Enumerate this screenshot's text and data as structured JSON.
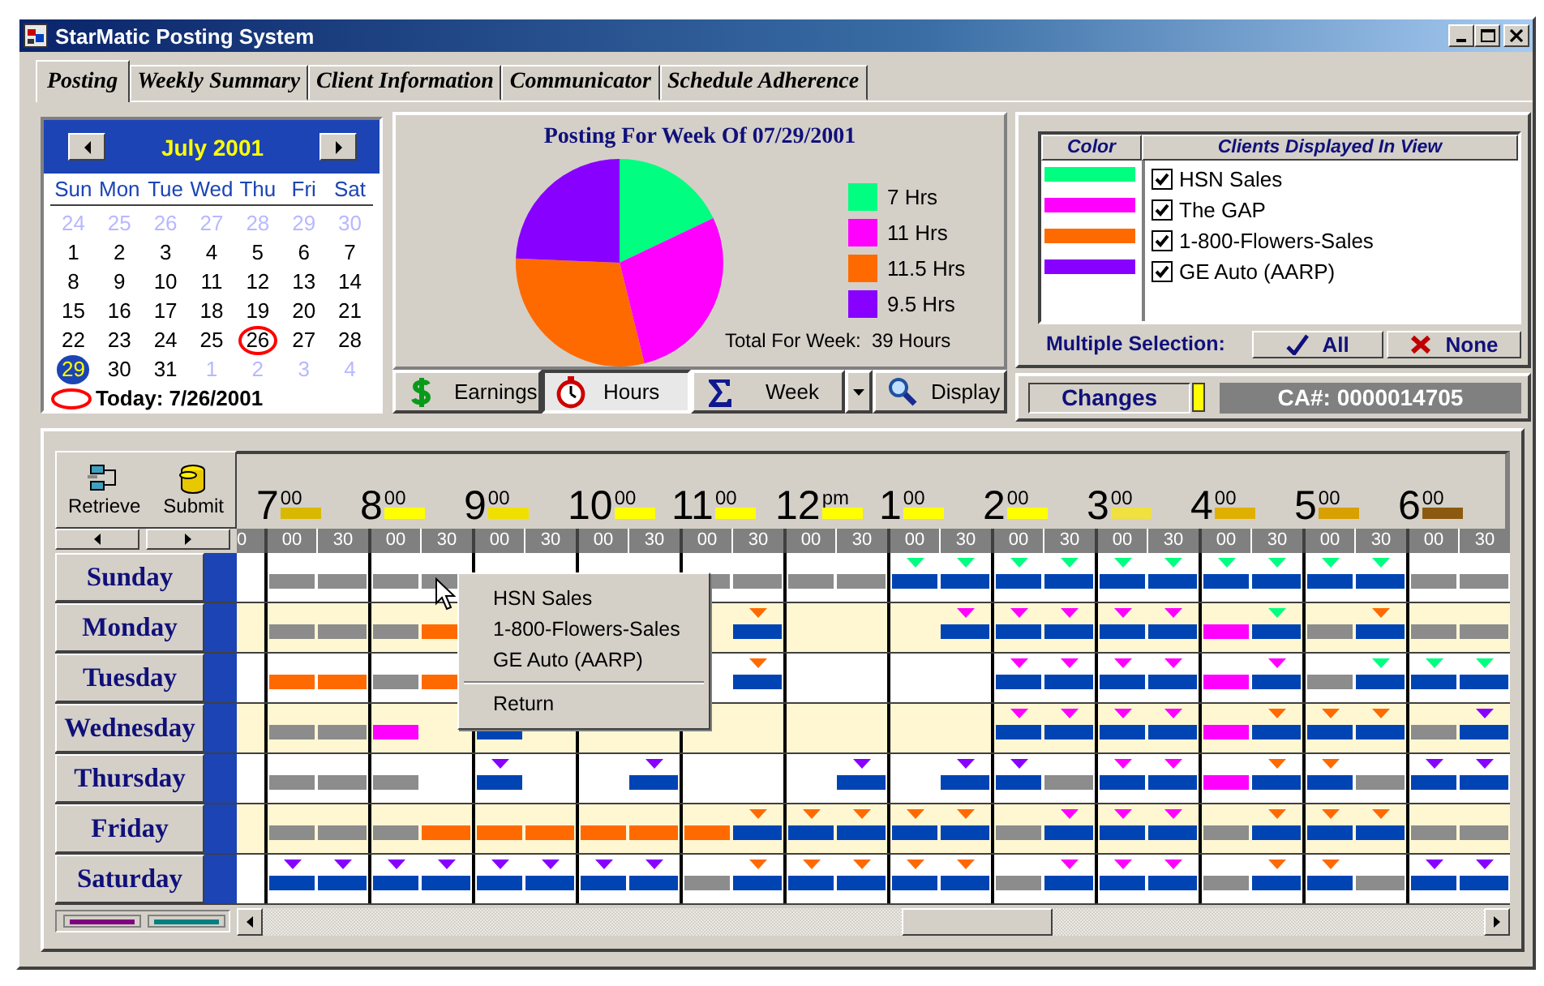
{
  "window": {
    "title": "StarMatic Posting System"
  },
  "tabs": [
    {
      "label": "Posting",
      "selected": true
    },
    {
      "label": "Weekly Summary",
      "selected": false
    },
    {
      "label": "Client Information",
      "selected": false
    },
    {
      "label": "Communicator",
      "selected": false
    },
    {
      "label": "Schedule Adherence",
      "selected": false
    }
  ],
  "calendar": {
    "month": "July 2001",
    "weekdays": [
      "Sun",
      "Mon",
      "Tue",
      "Wed",
      "Thu",
      "Fri",
      "Sat"
    ],
    "days": [
      {
        "label": "24",
        "kind": "other",
        "selected": false,
        "today": false
      },
      {
        "label": "25",
        "kind": "other",
        "selected": false,
        "today": false
      },
      {
        "label": "26",
        "kind": "other",
        "selected": false,
        "today": false
      },
      {
        "label": "27",
        "kind": "other",
        "selected": false,
        "today": false
      },
      {
        "label": "28",
        "kind": "other",
        "selected": false,
        "today": false
      },
      {
        "label": "29",
        "kind": "other",
        "selected": false,
        "today": false
      },
      {
        "label": "30",
        "kind": "other",
        "selected": false,
        "today": false
      },
      {
        "label": "1",
        "kind": "current",
        "selected": false,
        "today": false
      },
      {
        "label": "2",
        "kind": "current",
        "selected": false,
        "today": false
      },
      {
        "label": "3",
        "kind": "current",
        "selected": false,
        "today": false
      },
      {
        "label": "4",
        "kind": "current",
        "selected": false,
        "today": false
      },
      {
        "label": "5",
        "kind": "current",
        "selected": false,
        "today": false
      },
      {
        "label": "6",
        "kind": "current",
        "selected": false,
        "today": false
      },
      {
        "label": "7",
        "kind": "current",
        "selected": false,
        "today": false
      },
      {
        "label": "8",
        "kind": "current",
        "selected": false,
        "today": false
      },
      {
        "label": "9",
        "kind": "current",
        "selected": false,
        "today": false
      },
      {
        "label": "10",
        "kind": "current",
        "selected": false,
        "today": false
      },
      {
        "label": "11",
        "kind": "current",
        "selected": false,
        "today": false
      },
      {
        "label": "12",
        "kind": "current",
        "selected": false,
        "today": false
      },
      {
        "label": "13",
        "kind": "current",
        "selected": false,
        "today": false
      },
      {
        "label": "14",
        "kind": "current",
        "selected": false,
        "today": false
      },
      {
        "label": "15",
        "kind": "current",
        "selected": false,
        "today": false
      },
      {
        "label": "16",
        "kind": "current",
        "selected": false,
        "today": false
      },
      {
        "label": "17",
        "kind": "current",
        "selected": false,
        "today": false
      },
      {
        "label": "18",
        "kind": "current",
        "selected": false,
        "today": false
      },
      {
        "label": "19",
        "kind": "current",
        "selected": false,
        "today": false
      },
      {
        "label": "20",
        "kind": "current",
        "selected": false,
        "today": false
      },
      {
        "label": "21",
        "kind": "current",
        "selected": false,
        "today": false
      },
      {
        "label": "22",
        "kind": "current",
        "selected": false,
        "today": false
      },
      {
        "label": "23",
        "kind": "current",
        "selected": false,
        "today": false
      },
      {
        "label": "24",
        "kind": "current",
        "selected": false,
        "today": false
      },
      {
        "label": "25",
        "kind": "current",
        "selected": false,
        "today": false
      },
      {
        "label": "26",
        "kind": "current",
        "selected": false,
        "today": true
      },
      {
        "label": "27",
        "kind": "current",
        "selected": false,
        "today": false
      },
      {
        "label": "28",
        "kind": "current",
        "selected": false,
        "today": false
      },
      {
        "label": "29",
        "kind": "current",
        "selected": true,
        "today": false
      },
      {
        "label": "30",
        "kind": "current",
        "selected": false,
        "today": false
      },
      {
        "label": "31",
        "kind": "current",
        "selected": false,
        "today": false
      },
      {
        "label": "1",
        "kind": "other",
        "selected": false,
        "today": false
      },
      {
        "label": "2",
        "kind": "other",
        "selected": false,
        "today": false
      },
      {
        "label": "3",
        "kind": "other",
        "selected": false,
        "today": false
      },
      {
        "label": "4",
        "kind": "other",
        "selected": false,
        "today": false
      }
    ],
    "today_label": "Today: 7/26/2001"
  },
  "chart_panel": {
    "chart_data": {
      "type": "pie",
      "title": "Posting For Week Of 07/29/2001",
      "categories": [
        "7 Hrs",
        "11 Hrs",
        "11.5 Hrs",
        "9.5 Hrs"
      ],
      "values": [
        7,
        11,
        11.5,
        9.5
      ],
      "colors": [
        "#00ff80",
        "#ff00ff",
        "#ff6a00",
        "#8800ff"
      ],
      "legend": "right"
    },
    "total": "Total For Week:  39 Hours"
  },
  "view_buttons": [
    {
      "label": "Earnings",
      "kind": "button",
      "selected": false
    },
    {
      "label": "Hours",
      "kind": "button",
      "selected": true
    },
    {
      "label": "Week",
      "kind": "dropdown",
      "selected": false
    },
    {
      "label": "Display",
      "kind": "button",
      "selected": false
    }
  ],
  "clients": {
    "headers": [
      "Color",
      "Clients Displayed In View"
    ],
    "items": [
      {
        "name": "HSN Sales",
        "color": "#00ff80",
        "checked": true
      },
      {
        "name": "The GAP",
        "color": "#ff00ff",
        "checked": true
      },
      {
        "name": "1-800-Flowers-Sales",
        "color": "#ff6a00",
        "checked": true
      },
      {
        "name": "GE Auto (AARP)",
        "color": "#8800ff",
        "checked": true
      }
    ],
    "selection_label": "Multiple Selection:",
    "buttons": [
      "All",
      "None"
    ]
  },
  "status": {
    "changes": "Changes",
    "account": "CA#: 0000014705"
  },
  "schedule": {
    "tools": [
      "Retrieve",
      "Submit"
    ],
    "hours": [
      {
        "hour": "7",
        "suffix": "00",
        "color": "#d8b800"
      },
      {
        "hour": "8",
        "suffix": "00",
        "color": "#ffff00"
      },
      {
        "hour": "9",
        "suffix": "00",
        "color": "#f0e000"
      },
      {
        "hour": "10",
        "suffix": "00",
        "color": "#ffff00"
      },
      {
        "hour": "11",
        "suffix": "00",
        "color": "#ffff00"
      },
      {
        "hour": "12",
        "suffix": "pm",
        "color": "#ffff00"
      },
      {
        "hour": "1",
        "suffix": "00",
        "color": "#ffff00"
      },
      {
        "hour": "2",
        "suffix": "00",
        "color": "#ffff00"
      },
      {
        "hour": "3",
        "suffix": "00",
        "color": "#f0e040"
      },
      {
        "hour": "4",
        "suffix": "00",
        "color": "#e0b000"
      },
      {
        "hour": "5",
        "suffix": "00",
        "color": "#d8a000"
      },
      {
        "hour": "6",
        "suffix": "00",
        "color": "#8b5a10"
      }
    ],
    "minute_marks": [
      "0",
      "00",
      "30",
      "00",
      "30",
      "00",
      "30",
      "00",
      "30",
      "00",
      "30",
      "00",
      "30",
      "00",
      "30",
      "00",
      "30",
      "00",
      "30",
      "00",
      "30",
      "00",
      "30",
      "00",
      "30"
    ],
    "days": [
      {
        "name": "Sunday",
        "slots": [
          {
            "kind": "bar",
            "color": "#8c8c8c"
          },
          {
            "kind": "bar",
            "color": "#8c8c8c"
          },
          {
            "kind": "bar",
            "color": "#8c8c8c"
          },
          {
            "kind": "bar",
            "color": "#8c8c8c"
          },
          {
            "kind": "empty"
          },
          {
            "kind": "empty"
          },
          {
            "kind": "empty"
          },
          {
            "kind": "empty"
          },
          {
            "kind": "bar",
            "color": "#8c8c8c"
          },
          {
            "kind": "bar",
            "color": "#8c8c8c"
          },
          {
            "kind": "bar",
            "color": "#8c8c8c"
          },
          {
            "kind": "bar",
            "color": "#8c8c8c"
          },
          {
            "kind": "bar",
            "color": "#0044b4",
            "marker": {
              "color": "#00ff80"
            }
          },
          {
            "kind": "bar",
            "color": "#0044b4",
            "marker": {
              "color": "#00ff80"
            }
          },
          {
            "kind": "bar",
            "color": "#0044b4",
            "marker": {
              "color": "#00ff80"
            }
          },
          {
            "kind": "bar",
            "color": "#0044b4",
            "marker": {
              "color": "#00ff80"
            }
          },
          {
            "kind": "bar",
            "color": "#0044b4",
            "marker": {
              "color": "#00ff80"
            }
          },
          {
            "kind": "bar",
            "color": "#0044b4",
            "marker": {
              "color": "#00ff80"
            }
          },
          {
            "kind": "bar",
            "color": "#0044b4",
            "marker": {
              "color": "#00ff80"
            }
          },
          {
            "kind": "bar",
            "color": "#0044b4",
            "marker": {
              "color": "#00ff80"
            }
          },
          {
            "kind": "bar",
            "color": "#0044b4",
            "marker": {
              "color": "#00ff80"
            }
          },
          {
            "kind": "bar",
            "color": "#0044b4",
            "marker": {
              "color": "#00ff80"
            }
          },
          {
            "kind": "bar",
            "color": "#8c8c8c"
          },
          {
            "kind": "bar",
            "color": "#8c8c8c"
          }
        ]
      },
      {
        "name": "Monday",
        "slots": [
          {
            "kind": "bar",
            "color": "#8c8c8c"
          },
          {
            "kind": "bar",
            "color": "#8c8c8c"
          },
          {
            "kind": "bar",
            "color": "#8c8c8c"
          },
          {
            "kind": "bar",
            "color": "#ff6a00"
          },
          {
            "kind": "empty"
          },
          {
            "kind": "empty"
          },
          {
            "kind": "empty"
          },
          {
            "kind": "empty"
          },
          {
            "kind": "empty"
          },
          {
            "kind": "bar",
            "color": "#0044b4",
            "marker": {
              "color": "#ff6a00"
            }
          },
          {
            "kind": "empty"
          },
          {
            "kind": "empty"
          },
          {
            "kind": "empty"
          },
          {
            "kind": "bar",
            "color": "#0044b4",
            "marker": {
              "color": "#ff00ff"
            }
          },
          {
            "kind": "bar",
            "color": "#0044b4",
            "marker": {
              "color": "#ff00ff"
            }
          },
          {
            "kind": "bar",
            "color": "#0044b4",
            "marker": {
              "color": "#ff00ff"
            }
          },
          {
            "kind": "bar",
            "color": "#0044b4",
            "marker": {
              "color": "#ff00ff"
            }
          },
          {
            "kind": "bar",
            "color": "#0044b4",
            "marker": {
              "color": "#ff00ff"
            }
          },
          {
            "kind": "bar",
            "color": "#ff00ff"
          },
          {
            "kind": "bar",
            "color": "#0044b4",
            "marker": {
              "color": "#00ff80"
            }
          },
          {
            "kind": "bar",
            "color": "#8c8c8c"
          },
          {
            "kind": "bar",
            "color": "#0044b4",
            "marker": {
              "color": "#ff6a00"
            }
          },
          {
            "kind": "bar",
            "color": "#8c8c8c"
          },
          {
            "kind": "bar",
            "color": "#8c8c8c"
          }
        ]
      },
      {
        "name": "Tuesday",
        "slots": [
          {
            "kind": "bar",
            "color": "#ff6a00"
          },
          {
            "kind": "bar",
            "color": "#ff6a00"
          },
          {
            "kind": "bar",
            "color": "#8c8c8c"
          },
          {
            "kind": "bar",
            "color": "#ff6a00"
          },
          {
            "kind": "empty"
          },
          {
            "kind": "empty"
          },
          {
            "kind": "empty"
          },
          {
            "kind": "empty"
          },
          {
            "kind": "empty"
          },
          {
            "kind": "bar",
            "color": "#0044b4",
            "marker": {
              "color": "#ff6a00"
            }
          },
          {
            "kind": "empty"
          },
          {
            "kind": "empty"
          },
          {
            "kind": "empty"
          },
          {
            "kind": "empty"
          },
          {
            "kind": "bar",
            "color": "#0044b4",
            "marker": {
              "color": "#ff00ff"
            }
          },
          {
            "kind": "bar",
            "color": "#0044b4",
            "marker": {
              "color": "#ff00ff"
            }
          },
          {
            "kind": "bar",
            "color": "#0044b4",
            "marker": {
              "color": "#ff00ff"
            }
          },
          {
            "kind": "bar",
            "color": "#0044b4",
            "marker": {
              "color": "#ff00ff"
            }
          },
          {
            "kind": "bar",
            "color": "#ff00ff"
          },
          {
            "kind": "bar",
            "color": "#0044b4",
            "marker": {
              "color": "#ff00ff"
            }
          },
          {
            "kind": "bar",
            "color": "#8c8c8c"
          },
          {
            "kind": "bar",
            "color": "#0044b4",
            "marker": {
              "color": "#00ff80"
            }
          },
          {
            "kind": "bar",
            "color": "#0044b4",
            "marker": {
              "color": "#00ff80"
            }
          },
          {
            "kind": "bar",
            "color": "#0044b4",
            "marker": {
              "color": "#00ff80"
            }
          }
        ]
      },
      {
        "name": "Wednesday",
        "slots": [
          {
            "kind": "bar",
            "color": "#8c8c8c"
          },
          {
            "kind": "bar",
            "color": "#8c8c8c"
          },
          {
            "kind": "bar",
            "color": "#ff00ff"
          },
          {
            "kind": "empty"
          },
          {
            "kind": "bar",
            "color": "#0044b4"
          },
          {
            "kind": "empty"
          },
          {
            "kind": "empty"
          },
          {
            "kind": "empty"
          },
          {
            "kind": "empty"
          },
          {
            "kind": "empty"
          },
          {
            "kind": "empty"
          },
          {
            "kind": "empty"
          },
          {
            "kind": "empty"
          },
          {
            "kind": "empty"
          },
          {
            "kind": "bar",
            "color": "#0044b4",
            "marker": {
              "color": "#ff00ff"
            }
          },
          {
            "kind": "bar",
            "color": "#0044b4",
            "marker": {
              "color": "#ff00ff"
            }
          },
          {
            "kind": "bar",
            "color": "#0044b4",
            "marker": {
              "color": "#ff00ff"
            }
          },
          {
            "kind": "bar",
            "color": "#0044b4",
            "marker": {
              "color": "#ff00ff"
            }
          },
          {
            "kind": "bar",
            "color": "#ff00ff"
          },
          {
            "kind": "bar",
            "color": "#0044b4",
            "marker": {
              "color": "#ff6a00"
            }
          },
          {
            "kind": "bar",
            "color": "#0044b4",
            "marker": {
              "color": "#ff6a00"
            }
          },
          {
            "kind": "bar",
            "color": "#0044b4",
            "marker": {
              "color": "#ff6a00"
            }
          },
          {
            "kind": "bar",
            "color": "#8c8c8c"
          },
          {
            "kind": "bar",
            "color": "#0044b4",
            "marker": {
              "color": "#8800ff"
            }
          }
        ]
      },
      {
        "name": "Thursday",
        "slots": [
          {
            "kind": "bar",
            "color": "#8c8c8c"
          },
          {
            "kind": "bar",
            "color": "#8c8c8c"
          },
          {
            "kind": "bar",
            "color": "#8c8c8c"
          },
          {
            "kind": "empty"
          },
          {
            "kind": "bar",
            "color": "#0044b4",
            "marker": {
              "color": "#8800ff"
            }
          },
          {
            "kind": "empty"
          },
          {
            "kind": "empty"
          },
          {
            "kind": "bar",
            "color": "#0044b4",
            "marker": {
              "color": "#8800ff"
            }
          },
          {
            "kind": "empty"
          },
          {
            "kind": "empty"
          },
          {
            "kind": "empty"
          },
          {
            "kind": "bar",
            "color": "#0044b4",
            "marker": {
              "color": "#8800ff"
            }
          },
          {
            "kind": "empty"
          },
          {
            "kind": "bar",
            "color": "#0044b4",
            "marker": {
              "color": "#8800ff"
            }
          },
          {
            "kind": "bar",
            "color": "#0044b4",
            "marker": {
              "color": "#8800ff"
            }
          },
          {
            "kind": "bar",
            "color": "#8c8c8c"
          },
          {
            "kind": "bar",
            "color": "#0044b4",
            "marker": {
              "color": "#ff00ff"
            }
          },
          {
            "kind": "bar",
            "color": "#0044b4",
            "marker": {
              "color": "#ff00ff"
            }
          },
          {
            "kind": "bar",
            "color": "#ff00ff"
          },
          {
            "kind": "bar",
            "color": "#0044b4",
            "marker": {
              "color": "#ff6a00"
            }
          },
          {
            "kind": "bar",
            "color": "#0044b4",
            "marker": {
              "color": "#ff6a00"
            }
          },
          {
            "kind": "bar",
            "color": "#8c8c8c"
          },
          {
            "kind": "bar",
            "color": "#0044b4",
            "marker": {
              "color": "#8800ff"
            }
          },
          {
            "kind": "bar",
            "color": "#0044b4",
            "marker": {
              "color": "#8800ff"
            }
          }
        ]
      },
      {
        "name": "Friday",
        "slots": [
          {
            "kind": "bar",
            "color": "#8c8c8c"
          },
          {
            "kind": "bar",
            "color": "#8c8c8c"
          },
          {
            "kind": "bar",
            "color": "#8c8c8c"
          },
          {
            "kind": "bar",
            "color": "#ff6a00"
          },
          {
            "kind": "bar",
            "color": "#ff6a00"
          },
          {
            "kind": "bar",
            "color": "#ff6a00"
          },
          {
            "kind": "bar",
            "color": "#ff6a00"
          },
          {
            "kind": "bar",
            "color": "#ff6a00"
          },
          {
            "kind": "bar",
            "color": "#ff6a00"
          },
          {
            "kind": "bar",
            "color": "#0044b4",
            "marker": {
              "color": "#ff6a00"
            }
          },
          {
            "kind": "bar",
            "color": "#0044b4",
            "marker": {
              "color": "#ff6a00"
            }
          },
          {
            "kind": "bar",
            "color": "#0044b4",
            "marker": {
              "color": "#ff6a00"
            }
          },
          {
            "kind": "bar",
            "color": "#0044b4",
            "marker": {
              "color": "#ff6a00"
            }
          },
          {
            "kind": "bar",
            "color": "#0044b4",
            "marker": {
              "color": "#ff6a00"
            }
          },
          {
            "kind": "bar",
            "color": "#8c8c8c"
          },
          {
            "kind": "bar",
            "color": "#0044b4",
            "marker": {
              "color": "#ff00ff"
            }
          },
          {
            "kind": "bar",
            "color": "#0044b4",
            "marker": {
              "color": "#ff00ff"
            }
          },
          {
            "kind": "bar",
            "color": "#0044b4",
            "marker": {
              "color": "#ff00ff"
            }
          },
          {
            "kind": "bar",
            "color": "#8c8c8c"
          },
          {
            "kind": "bar",
            "color": "#0044b4",
            "marker": {
              "color": "#ff6a00"
            }
          },
          {
            "kind": "bar",
            "color": "#0044b4",
            "marker": {
              "color": "#ff6a00"
            }
          },
          {
            "kind": "bar",
            "color": "#0044b4",
            "marker": {
              "color": "#ff6a00"
            }
          },
          {
            "kind": "bar",
            "color": "#8c8c8c"
          },
          {
            "kind": "bar",
            "color": "#8c8c8c"
          }
        ]
      },
      {
        "name": "Saturday",
        "slots": [
          {
            "kind": "bar",
            "color": "#0044b4",
            "marker": {
              "color": "#8800ff"
            }
          },
          {
            "kind": "bar",
            "color": "#0044b4",
            "marker": {
              "color": "#8800ff"
            }
          },
          {
            "kind": "bar",
            "color": "#0044b4",
            "marker": {
              "color": "#8800ff"
            }
          },
          {
            "kind": "bar",
            "color": "#0044b4",
            "marker": {
              "color": "#8800ff"
            }
          },
          {
            "kind": "bar",
            "color": "#0044b4",
            "marker": {
              "color": "#8800ff"
            }
          },
          {
            "kind": "bar",
            "color": "#0044b4",
            "marker": {
              "color": "#8800ff"
            }
          },
          {
            "kind": "bar",
            "color": "#0044b4",
            "marker": {
              "color": "#8800ff"
            }
          },
          {
            "kind": "bar",
            "color": "#0044b4",
            "marker": {
              "color": "#8800ff"
            }
          },
          {
            "kind": "bar",
            "color": "#8c8c8c"
          },
          {
            "kind": "bar",
            "color": "#0044b4",
            "marker": {
              "color": "#ff6a00"
            }
          },
          {
            "kind": "bar",
            "color": "#0044b4",
            "marker": {
              "color": "#ff6a00"
            }
          },
          {
            "kind": "bar",
            "color": "#0044b4",
            "marker": {
              "color": "#ff6a00"
            }
          },
          {
            "kind": "bar",
            "color": "#0044b4",
            "marker": {
              "color": "#ff6a00"
            }
          },
          {
            "kind": "bar",
            "color": "#0044b4",
            "marker": {
              "color": "#ff6a00"
            }
          },
          {
            "kind": "bar",
            "color": "#8c8c8c"
          },
          {
            "kind": "bar",
            "color": "#0044b4",
            "marker": {
              "color": "#ff00ff"
            }
          },
          {
            "kind": "bar",
            "color": "#0044b4",
            "marker": {
              "color": "#ff00ff"
            }
          },
          {
            "kind": "bar",
            "color": "#0044b4",
            "marker": {
              "color": "#ff00ff"
            }
          },
          {
            "kind": "bar",
            "color": "#8c8c8c"
          },
          {
            "kind": "bar",
            "color": "#0044b4",
            "marker": {
              "color": "#ff6a00"
            }
          },
          {
            "kind": "bar",
            "color": "#0044b4",
            "marker": {
              "color": "#ff6a00"
            }
          },
          {
            "kind": "bar",
            "color": "#8c8c8c"
          },
          {
            "kind": "bar",
            "color": "#0044b4",
            "marker": {
              "color": "#8800ff"
            }
          },
          {
            "kind": "bar",
            "color": "#0044b4",
            "marker": {
              "color": "#8800ff"
            }
          }
        ]
      }
    ]
  },
  "context_menu": {
    "items": [
      "HSN Sales",
      "1-800-Flowers-Sales",
      "GE Auto (AARP)"
    ],
    "footer": "Return"
  }
}
